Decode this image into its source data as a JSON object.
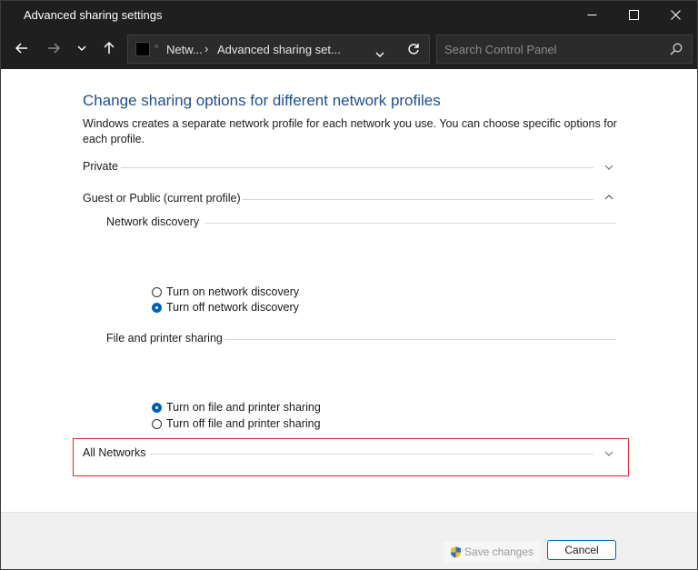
{
  "window": {
    "title": "Advanced sharing settings"
  },
  "navbar": {
    "breadcrumb_1": "Netw...",
    "breadcrumb_2": "Advanced sharing set...",
    "search_placeholder": "Search Control Panel"
  },
  "main": {
    "heading": "Change sharing options for different network profiles",
    "description": "Windows creates a separate network profile for each network you use. You can choose specific options for each profile.",
    "profiles": {
      "private": "Private",
      "guest_public": "Guest or Public (current profile)",
      "all_networks": "All Networks"
    },
    "network_discovery": {
      "title": "Network discovery",
      "option_on": "Turn on network discovery",
      "option_off": "Turn off network discovery",
      "selected": "off"
    },
    "file_printer_sharing": {
      "title": "File and printer sharing",
      "option_on": "Turn on file and printer sharing",
      "option_off": "Turn off file and printer sharing",
      "selected": "on"
    }
  },
  "footer": {
    "save_label": "Save changes",
    "cancel_label": "Cancel"
  },
  "colors": {
    "accent": "#0063b1",
    "heading": "#1e4e8c",
    "highlight_border": "#e0262b",
    "titlebar": "#1f1f1f"
  }
}
